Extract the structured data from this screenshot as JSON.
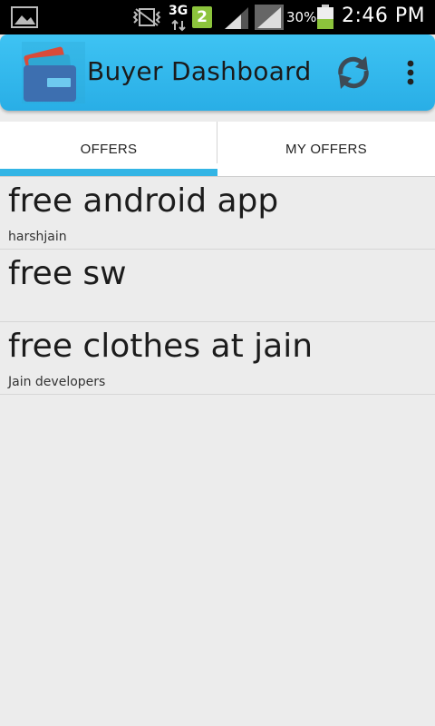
{
  "status_bar": {
    "network_type": "3G",
    "sim_slot": "2",
    "battery_percent": "30%",
    "time": "2:46 PM",
    "icons": [
      "gallery-icon",
      "vibrate-mute-icon",
      "data-arrows-icon",
      "signal-icon",
      "signal-alt-icon",
      "battery-icon"
    ]
  },
  "action_bar": {
    "title": "Buyer Dashboard",
    "icons": [
      "wallet-logo-icon",
      "refresh-icon",
      "overflow-menu-icon"
    ],
    "accent_color": "#33b5e5"
  },
  "tabs": [
    {
      "label": "OFFERS",
      "selected": true
    },
    {
      "label": "MY OFFERS",
      "selected": false
    }
  ],
  "offers": [
    {
      "title": "free android app",
      "seller": "harshjain"
    },
    {
      "title": "free sw",
      "seller": ""
    },
    {
      "title": "free clothes at jain",
      "seller": "Jain developers"
    }
  ]
}
